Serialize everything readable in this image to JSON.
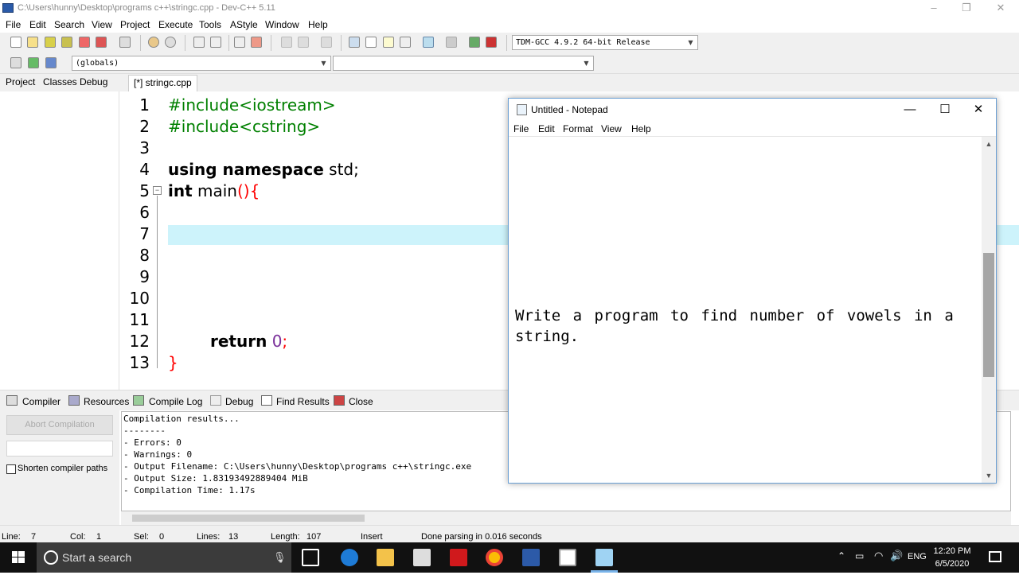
{
  "window": {
    "title": "C:\\Users\\hunny\\Desktop\\programs c++\\stringc.cpp - Dev-C++ 5.11"
  },
  "menu": [
    "File",
    "Edit",
    "Search",
    "View",
    "Project",
    "Execute",
    "Tools",
    "AStyle",
    "Window",
    "Help"
  ],
  "toolbar": {
    "compiler_select": "TDM-GCC 4.9.2 64-bit Release",
    "scope_select": "(globals)",
    "symbol_select": ""
  },
  "panel_tabs": [
    "Project",
    "Classes",
    "Debug"
  ],
  "editor": {
    "tab_label": "[*] stringc.cpp",
    "line_numbers": [
      "1",
      "2",
      "3",
      "4",
      "5",
      "6",
      "7",
      "8",
      "9",
      "10",
      "11",
      "12",
      "13"
    ],
    "lines": {
      "l1": "#include<iostream>",
      "l2": "#include<cstring>",
      "l4_kw": "using namespace",
      "l4_rest": " std;",
      "l5_kw": "int",
      "l5_name": " main",
      "l5_paren": "(){",
      "l12_kw": "return",
      "l12_num": "0",
      "l12_semi": ";",
      "l13": "}"
    }
  },
  "bottom_tabs": [
    "Compiler",
    "Resources",
    "Compile Log",
    "Debug",
    "Find Results",
    "Close"
  ],
  "compile": {
    "abort_label": "Abort Compilation",
    "shorten_label": "Shorten compiler paths",
    "log": [
      "Compilation results...",
      "--------",
      "- Errors: 0",
      "- Warnings: 0",
      "- Output Filename: C:\\Users\\hunny\\Desktop\\programs c++\\stringc.exe",
      "- Output Size: 1.83193492889404 MiB",
      "- Compilation Time: 1.17s"
    ]
  },
  "status": {
    "line_label": "Line:",
    "line_value": "7",
    "col_label": "Col:",
    "col_value": "1",
    "sel_label": "Sel:",
    "sel_value": "0",
    "lines_label": "Lines:",
    "lines_value": "13",
    "length_label": "Length:",
    "length_value": "107",
    "mode": "Insert",
    "message": "Done parsing in 0.016 seconds"
  },
  "notepad": {
    "title": "Untitled - Notepad",
    "menu": [
      "File",
      "Edit",
      "Format",
      "View",
      "Help"
    ],
    "text": "Write a program to find number of vowels in a string."
  },
  "taskbar": {
    "search_placeholder": "Start a search",
    "lang": "ENG",
    "time": "12:20 PM",
    "date": "6/5/2020"
  },
  "colors": {
    "current_line": "#cdf3fb",
    "preprocessor": "#008000",
    "brace": "#ff0000",
    "number": "#7a2f9a",
    "taskbar": "#111111"
  }
}
